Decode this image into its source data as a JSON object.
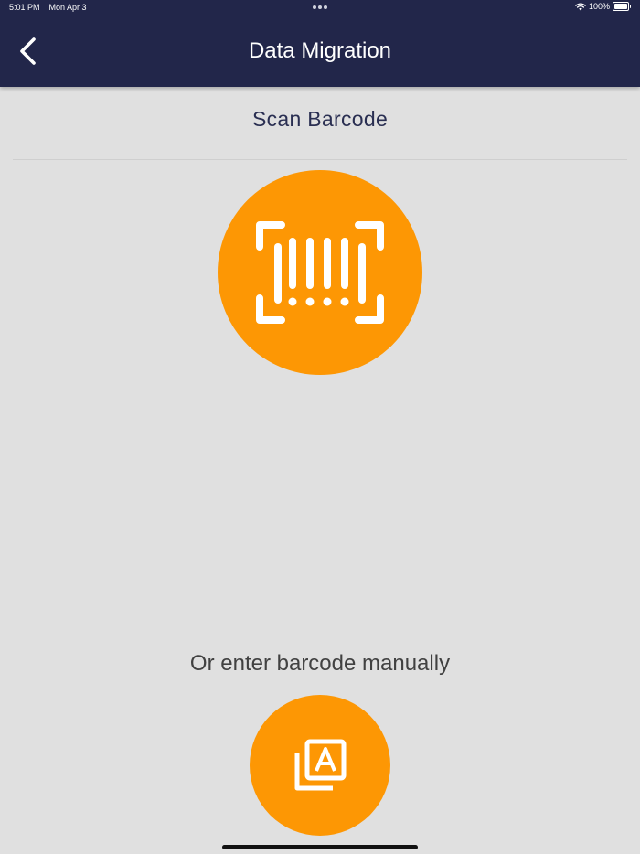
{
  "status_bar": {
    "time": "5:01 PM",
    "date": "Mon Apr 3",
    "battery": "100%"
  },
  "nav": {
    "title": "Data Migration",
    "back_icon": "chevron-left-icon"
  },
  "scan": {
    "title": "Scan Barcode",
    "icon": "barcode-scan-icon"
  },
  "manual": {
    "label": "Or enter barcode manually",
    "icon": "manual-entry-icon"
  },
  "colors": {
    "header": "#22264a",
    "accent": "#fd9704",
    "background": "#e0e0e0",
    "title_text": "#2a2f52"
  }
}
